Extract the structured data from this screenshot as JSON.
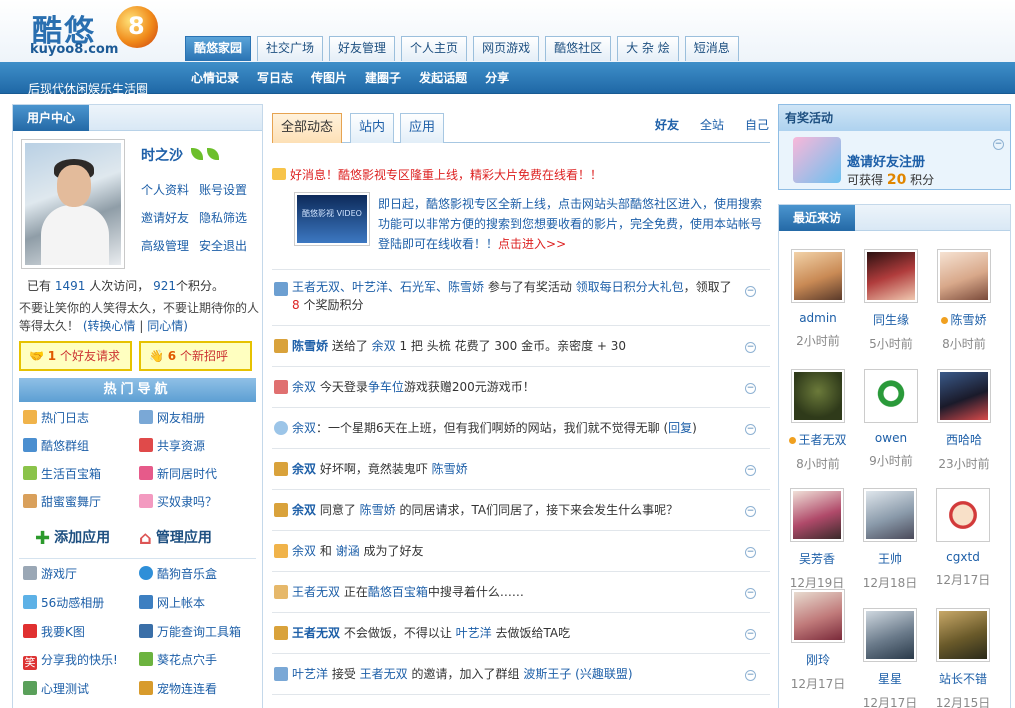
{
  "header": {
    "logo_text": "酷悠",
    "logo_badge": "8",
    "logo_url": "kuyoo8.com",
    "slogan": "后现代休闲娱乐生活圈",
    "tabs": [
      {
        "label": "酷悠家园"
      },
      {
        "label": "社交广场"
      },
      {
        "label": "好友管理"
      },
      {
        "label": "个人主页"
      },
      {
        "label": "网页游戏"
      },
      {
        "label": "酷悠社区"
      },
      {
        "label": "大 杂 烩"
      },
      {
        "label": "短消息"
      }
    ],
    "subnav": [
      {
        "label": "心情记录"
      },
      {
        "label": "写日志"
      },
      {
        "label": "传图片"
      },
      {
        "label": "建圈子"
      },
      {
        "label": "发起话题"
      },
      {
        "label": "分享"
      }
    ]
  },
  "user_center": {
    "title": "用户中心",
    "name": "时之沙",
    "links": [
      "个人资料",
      "账号设置",
      "邀请好友",
      "隐私筛选",
      "高级管理",
      "安全退出"
    ],
    "stats_prefix": "已有",
    "visits": "1491",
    "stats_mid": "人次访问，",
    "points": "921",
    "stats_suffix": "个积分。",
    "motto": "不要让笑你的人笑得太久，不要让期待你的人等得太久！",
    "motto_links": [
      "(转换心情",
      "|",
      "同心情)"
    ],
    "friend_requests_count": "1",
    "friend_requests_label": "个好友请求",
    "greetings_count": "6",
    "greetings_label": "个新招呼"
  },
  "hot_nav": {
    "title": "热门导航",
    "items": [
      "热门日志",
      "网友相册",
      "酷悠群组",
      "共享资源",
      "生活百宝箱",
      "新同居时代",
      "甜蜜蜜舞厅",
      "买奴隶吗？"
    ]
  },
  "apps": {
    "add_label": "添加应用",
    "manage_label": "管理应用",
    "items": [
      "游戏厅",
      "酷狗音乐盒",
      "56动感相册",
      "网上帐本",
      "我要K图",
      "万能查询工具箱",
      "分享我的快乐!",
      "葵花点穴手",
      "心理测试",
      "宠物连连看"
    ]
  },
  "feed": {
    "tabs": [
      "全部动态",
      "站内",
      "应用"
    ],
    "filters": [
      "好友",
      "全站",
      "自己"
    ],
    "news": {
      "title": "好消息！酷悠影视专区隆重上线，精彩大片免费在线看！！",
      "thumb_text": "酷悠影视 VIDEO",
      "body": "即日起，酷悠影视专区全新上线，点击网站头部酷悠社区进入，使用搜索功能可以非常方便的搜索到您想要收看的影片，完全免费，使用本站帐号登陆即可在线收看！！",
      "link": "点击进入>>"
    },
    "items": [
      {
        "a": "王者无双、叶艺洋、石光军、陈雪娇",
        "b": " 参与了有奖活动 ",
        "c": "领取每日积分大礼包",
        "d": "，领取了",
        "e": "8",
        "f": " 个奖励积分"
      },
      {
        "a": "陈雪娇",
        "b": " 送给了 ",
        "c": "余双",
        "d": " 1 把 头梳 花费了 300 金币。亲密度 + 30"
      },
      {
        "a": "余双",
        "b": " 今天登录",
        "c": "争车位",
        "d": "游戏获赠200元游戏币！"
      },
      {
        "a": "余双",
        "b": "：一个星期6天在上班，但有我们啊娇的网站，我们就不觉得无聊 (",
        "c": "回复",
        "d": ")"
      },
      {
        "a": "余双",
        "b": " 好坏啊，竟然装鬼吓 ",
        "c": "陈雪娇"
      },
      {
        "a": "余双",
        "b": " 同意了 ",
        "c": "陈雪娇",
        "d": " 的同居请求，TA们同居了，接下来会发生什么事呢？"
      },
      {
        "a": "余双",
        "b": " 和 ",
        "c": "谢涵",
        "d": " 成为了好友"
      },
      {
        "a": "王者无双",
        "b": " 正在",
        "c": "酷悠百宝箱",
        "d": "中搜寻着什么……"
      },
      {
        "a": "王者无双",
        "b": " 不会做饭，不得以让 ",
        "c": "叶艺洋",
        "d": " 去做饭给TA吃"
      },
      {
        "a": "叶艺洋",
        "b": " 接受 ",
        "c": "王者无双",
        "d": " 的邀请，加入了群组 ",
        "e": "波斯王子",
        "f": " (兴趣联盟)"
      }
    ],
    "collapse_symbol": "−"
  },
  "award": {
    "title": "有奖活动",
    "invite": "邀请好友注册",
    "score_prefix": "可获得",
    "score_value": "20",
    "score_suffix": "积分"
  },
  "visitors": {
    "title": "最近来访",
    "items": [
      {
        "name": "admin",
        "time": "2小时前"
      },
      {
        "name": "同生缘",
        "time": "5小时前"
      },
      {
        "name": "陈雪娇",
        "time": "8小时前"
      },
      {
        "name": "王者无双",
        "time": "8小时前"
      },
      {
        "name": "owen",
        "time": "9小时前"
      },
      {
        "name": "西哈哈",
        "time": "23小时前"
      },
      {
        "name": "吴芳香",
        "time": "12月19日"
      },
      {
        "name": "王帅",
        "time": "12月18日"
      },
      {
        "name": "cgxtd",
        "time": "12月17日"
      },
      {
        "name": "刚玲",
        "time": "12月17日"
      },
      {
        "name": "星星",
        "time": "12月17日"
      },
      {
        "name": "站长不错",
        "time": "12月15日"
      }
    ]
  },
  "colors": {
    "brand_blue": "#2a73b3",
    "link_blue": "#1d5fa8",
    "alert_red": "#d22",
    "highlight_orange": "#e08600"
  }
}
